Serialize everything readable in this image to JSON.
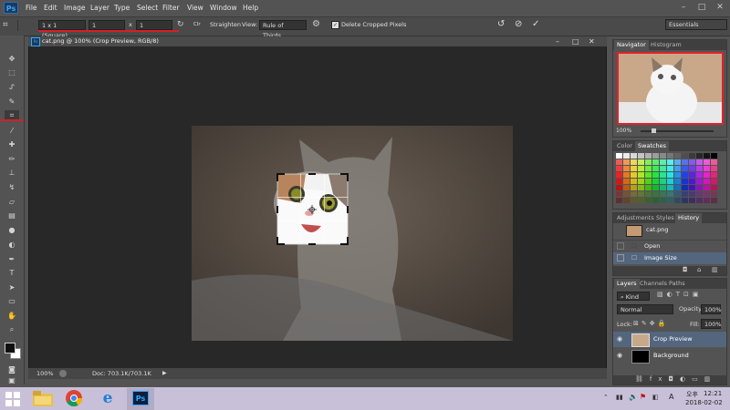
{
  "app": {
    "logo": "Ps"
  },
  "menu": [
    "File",
    "Edit",
    "Image",
    "Layer",
    "Type",
    "Select",
    "Filter",
    "View",
    "Window",
    "Help"
  ],
  "options": {
    "ratio": "1 x 1 (Square)",
    "width": "1",
    "times": "x",
    "height": "1",
    "straighten": "Straighten",
    "view_label": "View:",
    "view_value": "Rule of Thirds",
    "delete_cropped": "Delete Cropped Pixels",
    "workspace": "Essentials"
  },
  "document": {
    "tab_title": "cat.png @ 100% (Crop Preview, RGB/8)",
    "zoom": "100%",
    "doc_info": "Doc: 703.1K/703.1K"
  },
  "navigator": {
    "tabs": [
      "Navigator",
      "Histogram"
    ],
    "zoom": "100%"
  },
  "color_panel": {
    "tabs": [
      "Color",
      "Swatches"
    ]
  },
  "history_panel": {
    "tabs": [
      "Adjustments",
      "Styles",
      "History"
    ],
    "snapshot": "cat.png",
    "items": [
      "Open",
      "Image Size"
    ]
  },
  "layers_panel": {
    "tabs": [
      "Layers",
      "Channels",
      "Paths"
    ],
    "kind": "Kind",
    "blend": "Normal",
    "opacity_label": "Opacity:",
    "opacity": "100%",
    "lock_label": "Lock:",
    "fill_label": "Fill:",
    "fill": "100%",
    "layers": [
      "Crop Preview",
      "Background"
    ]
  },
  "taskbar": {
    "ime": "A",
    "ampm": "오후",
    "time": "12:21",
    "date": "2018-02-02"
  }
}
